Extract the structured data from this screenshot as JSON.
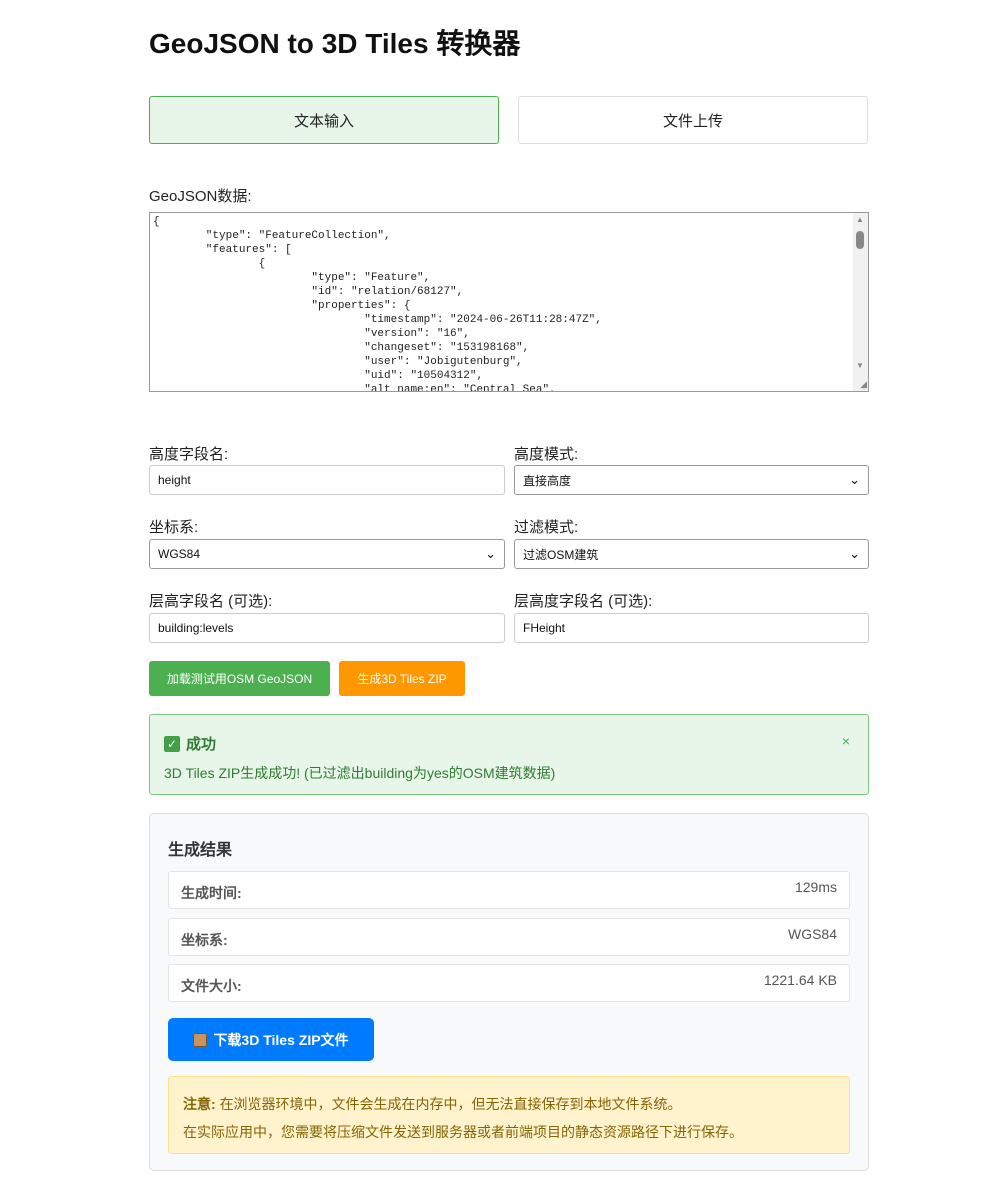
{
  "page_title": "GeoJSON to 3D Tiles 转换器",
  "tabs": [
    {
      "label": "文本输入",
      "active": true
    },
    {
      "label": "文件上传",
      "active": false
    }
  ],
  "geojson": {
    "label": "GeoJSON数据:",
    "value": "{\n        \"type\": \"FeatureCollection\",\n        \"features\": [\n                {\n                        \"type\": \"Feature\",\n                        \"id\": \"relation/68127\",\n                        \"properties\": {\n                                \"timestamp\": \"2024-06-26T11:28:47Z\",\n                                \"version\": \"16\",\n                                \"changeset\": \"153198168\",\n                                \"user\": \"Jobigutenburg\",\n                                \"uid\": \"10504312\",\n                                \"alt_name:en\": \"Central Sea\","
  },
  "form": {
    "height_field_label": "高度字段名:",
    "height_field_value": "height",
    "height_mode_label": "高度模式:",
    "height_mode_value": "直接高度",
    "crs_label": "坐标系:",
    "crs_value": "WGS84",
    "filter_mode_label": "过滤模式:",
    "filter_mode_value": "过滤OSM建筑",
    "floor_height_label": "层高字段名 (可选):",
    "floor_height_value": "building:levels",
    "floor_field_label": "层高度字段名 (可选):",
    "floor_field_value": "FHeight"
  },
  "buttons": {
    "load_test": "加载测试用OSM GeoJSON",
    "generate": "生成3D Tiles ZIP"
  },
  "alert": {
    "title": "成功",
    "message": "3D Tiles ZIP生成成功! (已过滤出building为yes的OSM建筑数据)",
    "close": "×",
    "color": "#2e7d32"
  },
  "results": {
    "title": "生成结果",
    "rows": [
      {
        "key": "生成时间:",
        "value": "129ms"
      },
      {
        "key": "坐标系:",
        "value": "WGS84"
      },
      {
        "key": "文件大小:",
        "value": "1221.64 KB"
      }
    ],
    "download_label": "下载3D Tiles ZIP文件",
    "note_strong": "注意:",
    "note_line1": "在浏览器环境中，文件会生成在内存中，但无法直接保存到本地文件系统。",
    "note_line2": "在实际应用中，您需要将压缩文件发送到服务器或者前端项目的静态资源路径下进行保存。"
  },
  "icons": {
    "chevron": "chevron-down-icon",
    "check": "check-icon",
    "box": "package-icon"
  }
}
